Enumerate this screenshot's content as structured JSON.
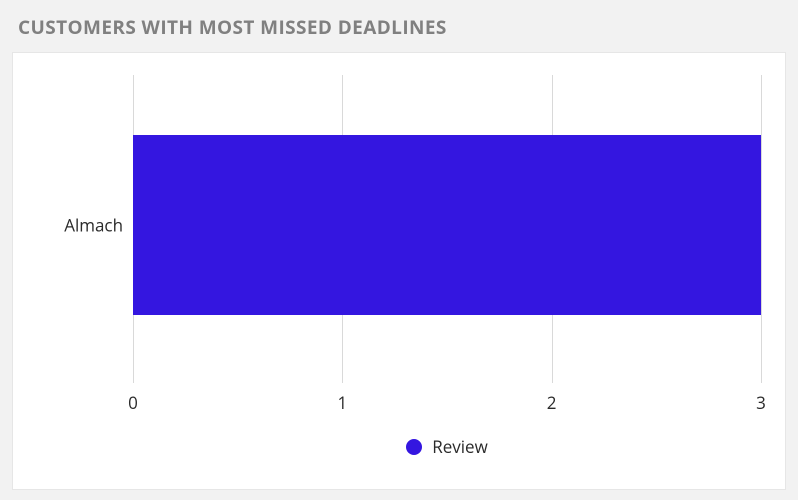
{
  "title": "CUSTOMERS WITH MOST MISSED DEADLINES",
  "chart_data": {
    "type": "bar",
    "orientation": "horizontal",
    "categories": [
      "Almach"
    ],
    "series": [
      {
        "name": "Review",
        "values": [
          3
        ],
        "color": "#3416e0"
      }
    ],
    "xlabel": "",
    "ylabel": "",
    "xlim": [
      0,
      3
    ],
    "x_ticks": [
      0,
      1,
      2,
      3
    ],
    "legend_position": "bottom"
  }
}
